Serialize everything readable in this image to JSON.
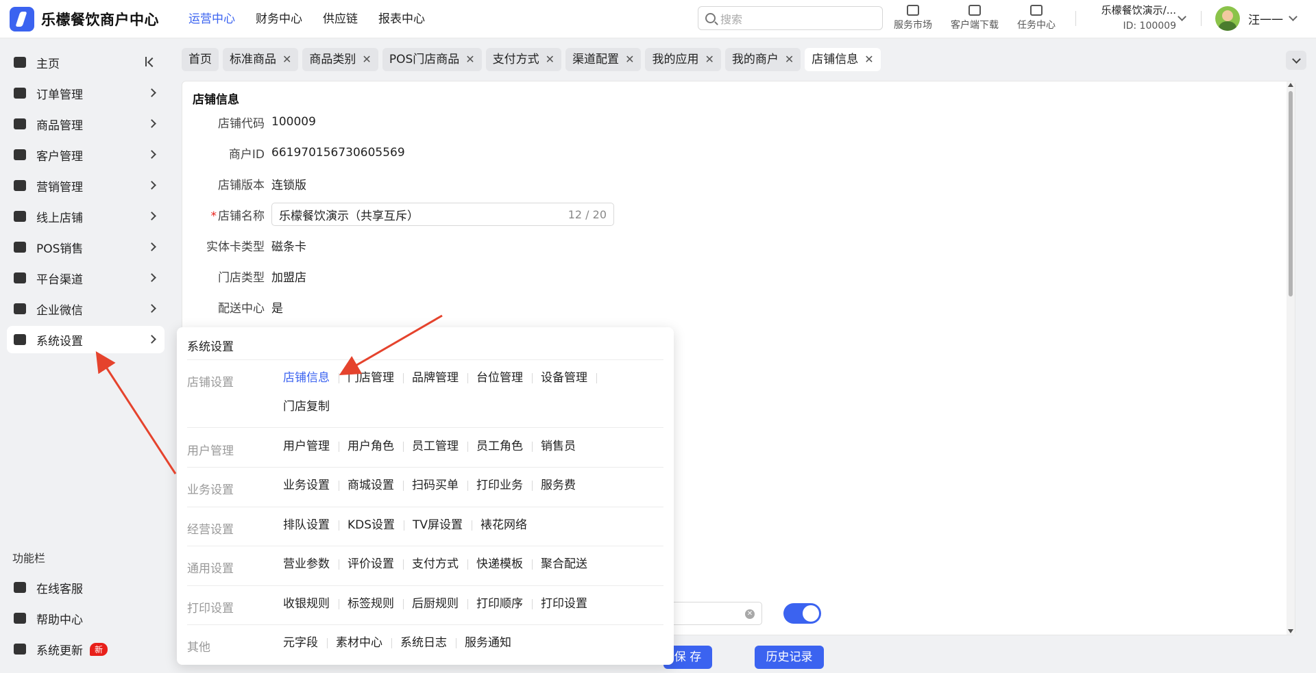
{
  "header": {
    "logo_text": "乐檬餐饮商户中心",
    "nav": [
      "运营中心",
      "财务中心",
      "供应链",
      "报表中心"
    ],
    "search_placeholder": "搜索",
    "tools": [
      "服务市场",
      "客户端下载",
      "任务中心"
    ],
    "merchant_name": "乐檬餐饮演示/...",
    "merchant_id": "ID: 100009",
    "user_name": "汪一一"
  },
  "sidebar": {
    "items": [
      {
        "label": "主页",
        "icon": "home-icon"
      },
      {
        "label": "订单管理",
        "icon": "order-icon"
      },
      {
        "label": "商品管理",
        "icon": "product-icon"
      },
      {
        "label": "客户管理",
        "icon": "customer-icon"
      },
      {
        "label": "营销管理",
        "icon": "tag-icon"
      },
      {
        "label": "线上店铺",
        "icon": "store-icon"
      },
      {
        "label": "POS销售",
        "icon": "pos-icon"
      },
      {
        "label": "平台渠道",
        "icon": "bank-icon"
      },
      {
        "label": "企业微信",
        "icon": "chat-icon"
      },
      {
        "label": "系统设置",
        "icon": "gear-icon"
      }
    ],
    "func_title": "功能栏",
    "func_items": [
      {
        "label": "在线客服",
        "icon": "headset-icon"
      },
      {
        "label": "帮助中心",
        "icon": "help-icon"
      },
      {
        "label": "系统更新",
        "icon": "refresh-icon",
        "badge": "新"
      }
    ]
  },
  "tabs": [
    {
      "label": "首页",
      "closable": false
    },
    {
      "label": "标准商品",
      "closable": true
    },
    {
      "label": "商品类别",
      "closable": true
    },
    {
      "label": "POS门店商品",
      "closable": true
    },
    {
      "label": "支付方式",
      "closable": true
    },
    {
      "label": "渠道配置",
      "closable": true
    },
    {
      "label": "我的应用",
      "closable": true
    },
    {
      "label": "我的商户",
      "closable": true
    },
    {
      "label": "店铺信息",
      "closable": true,
      "active": true
    }
  ],
  "store_info": {
    "title": "店铺信息",
    "fields": [
      {
        "label": "店铺代码",
        "value": "100009"
      },
      {
        "label": "商户ID",
        "value": "661970156730605569"
      },
      {
        "label": "店铺版本",
        "value": "连锁版"
      },
      {
        "label": "店铺名称",
        "value": "乐檬餐饮演示（共享互斥）",
        "required": true,
        "count": "12 / 20"
      },
      {
        "label": "实体卡类型",
        "value": "磁条卡"
      },
      {
        "label": "门店类型",
        "value": "加盟店"
      },
      {
        "label": "配送中心",
        "value": "是"
      }
    ]
  },
  "buttons": {
    "save": "保 存",
    "history": "历史记录"
  },
  "popup": {
    "title": "系统设置",
    "groups": [
      {
        "label": "店铺设置",
        "links": [
          "店铺信息",
          "门店管理",
          "品牌管理",
          "台位管理",
          "设备管理",
          "门店复制"
        ],
        "active": "店铺信息"
      },
      {
        "label": "用户管理",
        "links": [
          "用户管理",
          "用户角色",
          "员工管理",
          "员工角色",
          "销售员"
        ]
      },
      {
        "label": "业务设置",
        "links": [
          "业务设置",
          "商城设置",
          "扫码买单",
          "打印业务",
          "服务费"
        ]
      },
      {
        "label": "经营设置",
        "links": [
          "排队设置",
          "KDS设置",
          "TV屏设置",
          "裱花网络"
        ]
      },
      {
        "label": "通用设置",
        "links": [
          "营业参数",
          "评价设置",
          "支付方式",
          "快递模板",
          "聚合配送"
        ]
      },
      {
        "label": "打印设置",
        "links": [
          "收银规则",
          "标签规则",
          "后厨规则",
          "打印顺序",
          "打印设置"
        ]
      },
      {
        "label": "其他",
        "links": [
          "元字段",
          "素材中心",
          "系统日志",
          "服务通知"
        ]
      }
    ]
  },
  "colors": {
    "accent": "#3b63f0",
    "annotation_arrow": "#e5432d",
    "badge": "#e8201a"
  }
}
